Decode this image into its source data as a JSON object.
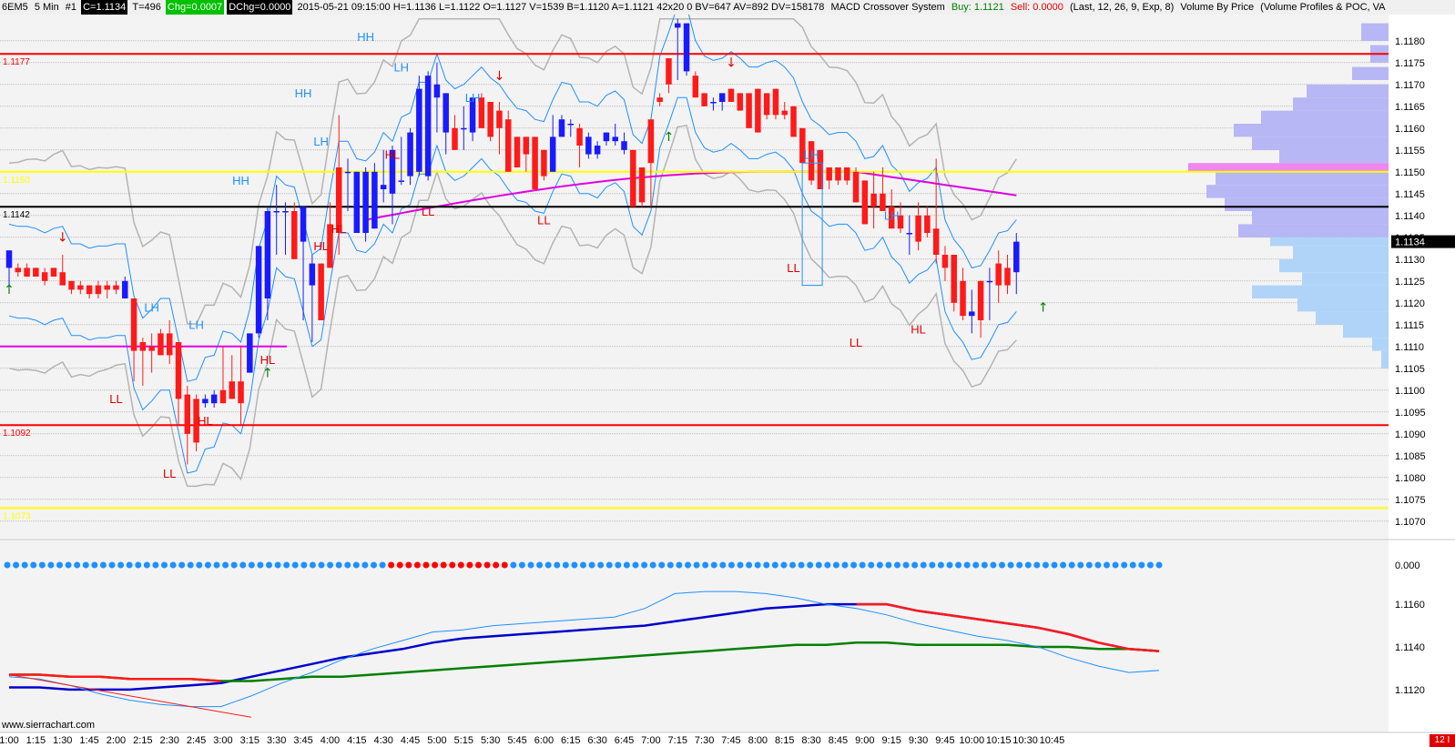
{
  "header": {
    "symbol": "6EM5",
    "timeframe": "5 Min",
    "chart_number": "#1",
    "close": "C=1.1134",
    "trades": "T=496",
    "chg": "Chg=0.0007",
    "dchg": "DChg=0.0000",
    "bar_info": "2015-05-21 09:15:00 H=1.1136 L=1.1122 O=1.1127 V=1539 B=1.1120 A=1.1121 42x20 0 BV=647 AV=892 DV=158178",
    "study": "MACD Crossover System",
    "buy": "Buy: 1.1121",
    "sell": "Sell: 0.0000",
    "study_params": "(Last, 12, 26, 9, Exp, 8)",
    "study2": "Volume By Price",
    "study3": "(Volume Profiles & POC, VA"
  },
  "footer": {
    "watermark": "www.sierrachart.com",
    "badge": "12 I"
  },
  "colors": {
    "bg": "#f3f3f3",
    "up": "#1a1aff",
    "down": "#ff1a1a",
    "grid": "#9a9a9a",
    "red_line": "#ff0000",
    "yellow_line": "#ffff00",
    "magenta": "#e000e0",
    "band_blue": "#1e90ff",
    "band_gray": "#b4b4b4",
    "label_blue": "#1e90ff",
    "label_red": "#e00000",
    "profile_a": "#b7b7f5",
    "profile_b": "#b0d4f8",
    "macd_fast": "#0000cc",
    "macd_signal": "#008000"
  },
  "chart_data": {
    "type": "candlestick",
    "price_axis": {
      "ylim": [
        1.1066,
        1.1186
      ],
      "ticks": [
        "1.1180",
        "1.1175",
        "1.1170",
        "1.1165",
        "1.1160",
        "1.1155",
        "1.1150",
        "1.1145",
        "1.1140",
        "1.1135",
        "1.1130",
        "1.1125",
        "1.1120",
        "1.1115",
        "1.1110",
        "1.1105",
        "1.1100",
        "1.1095",
        "1.1090",
        "1.1085",
        "1.1080",
        "1.1075",
        "1.1070"
      ],
      "current_price": "1.1134"
    },
    "time_labels": [
      "1:00",
      "1:15",
      "1:30",
      "1:45",
      "2:00",
      "2:15",
      "2:30",
      "2:45",
      "3:00",
      "3:15",
      "3:30",
      "3:45",
      "4:00",
      "4:15",
      "4:30",
      "4:45",
      "5:00",
      "5:15",
      "5:30",
      "5:45",
      "6:00",
      "6:15",
      "6:30",
      "6:45",
      "7:00",
      "7:15",
      "7:30",
      "7:45",
      "8:00",
      "8:15",
      "8:30",
      "8:45",
      "9:00",
      "9:15",
      "9:30",
      "9:45",
      "10:00",
      "10:15",
      "10:30",
      "10:45"
    ],
    "candles": [
      [
        1.1128,
        1.1132,
        1.1124,
        1.1132
      ],
      [
        1.1128,
        1.1129,
        1.1126,
        1.1127
      ],
      [
        1.1128,
        1.1129,
        1.1126,
        1.1126
      ],
      [
        1.1128,
        1.1128,
        1.1126,
        1.1126
      ],
      [
        1.1127,
        1.1128,
        1.1124,
        1.1125
      ],
      [
        1.1128,
        1.1128,
        1.1126,
        1.1126
      ],
      [
        1.1127,
        1.1131,
        1.1124,
        1.1124
      ],
      [
        1.1125,
        1.1125,
        1.1122,
        1.1123
      ],
      [
        1.1124,
        1.1125,
        1.1122,
        1.1123
      ],
      [
        1.1124,
        1.1124,
        1.1121,
        1.1122
      ],
      [
        1.1124,
        1.1125,
        1.1121,
        1.1122
      ],
      [
        1.1124,
        1.1125,
        1.1121,
        1.1123
      ],
      [
        1.1124,
        1.1125,
        1.1122,
        1.1123
      ],
      [
        1.1121,
        1.1126,
        1.1121,
        1.1125
      ],
      [
        1.1121,
        1.1121,
        1.1102,
        1.1109
      ],
      [
        1.1111,
        1.1112,
        1.1101,
        1.1109
      ],
      [
        1.111,
        1.1113,
        1.1104,
        1.1109
      ],
      [
        1.1113,
        1.1114,
        1.1108,
        1.1108
      ],
      [
        1.1113,
        1.1116,
        1.1106,
        1.1108
      ],
      [
        1.1111,
        1.1111,
        1.1092,
        1.1098
      ],
      [
        1.1099,
        1.1101,
        1.1083,
        1.109
      ],
      [
        1.1098,
        1.1099,
        1.1086,
        1.1088
      ],
      [
        1.1097,
        1.1099,
        1.1096,
        1.1098
      ],
      [
        1.1097,
        1.11,
        1.1096,
        1.1099
      ],
      [
        1.11,
        1.111,
        1.1097,
        1.1097
      ],
      [
        1.1102,
        1.1108,
        1.1098,
        1.1098
      ],
      [
        1.1102,
        1.111,
        1.1092,
        1.1097
      ],
      [
        1.1104,
        1.1113,
        1.1104,
        1.1113
      ],
      [
        1.1113,
        1.1133,
        1.1112,
        1.1133
      ],
      [
        1.1121,
        1.1142,
        1.1116,
        1.1141
      ],
      [
        1.1141,
        1.1147,
        1.1131,
        1.1141
      ],
      [
        1.1141,
        1.1143,
        1.1131,
        1.1141
      ],
      [
        1.1141,
        1.1143,
        1.113,
        1.113
      ],
      [
        1.1134,
        1.1142,
        1.1116,
        1.1142
      ],
      [
        1.1124,
        1.1131,
        1.1111,
        1.1129
      ],
      [
        1.1129,
        1.1129,
        1.1116,
        1.1116
      ],
      [
        1.1138,
        1.1143,
        1.1128,
        1.1128
      ],
      [
        1.1151,
        1.1163,
        1.1131,
        1.1136
      ],
      [
        1.115,
        1.1153,
        1.1141,
        1.115
      ],
      [
        1.1136,
        1.115,
        1.1136,
        1.115
      ],
      [
        1.1136,
        1.1151,
        1.1134,
        1.115
      ],
      [
        1.1137,
        1.1152,
        1.1137,
        1.115
      ],
      [
        1.1146,
        1.1155,
        1.1143,
        1.1147
      ],
      [
        1.1145,
        1.1156,
        1.1138,
        1.1155
      ],
      [
        1.1148,
        1.1158,
        1.1147,
        1.1148
      ],
      [
        1.1149,
        1.116,
        1.1147,
        1.1159
      ],
      [
        1.115,
        1.1172,
        1.1149,
        1.1169
      ],
      [
        1.1149,
        1.1173,
        1.1148,
        1.1172
      ],
      [
        1.1167,
        1.1175,
        1.1159,
        1.117
      ],
      [
        1.1159,
        1.1168,
        1.1154,
        1.1168
      ],
      [
        1.116,
        1.1163,
        1.1155,
        1.1155
      ],
      [
        1.116,
        1.1165,
        1.1155,
        1.116
      ],
      [
        1.1159,
        1.1167,
        1.1157,
        1.1167
      ],
      [
        1.1167,
        1.1168,
        1.116,
        1.116
      ],
      [
        1.1166,
        1.1166,
        1.1157,
        1.1158
      ],
      [
        1.1164,
        1.1166,
        1.1154,
        1.116
      ],
      [
        1.1162,
        1.1164,
        1.115,
        1.115
      ],
      [
        1.1158,
        1.1158,
        1.1151,
        1.1151
      ],
      [
        1.1158,
        1.1158,
        1.115,
        1.1154
      ],
      [
        1.1158,
        1.1158,
        1.1146,
        1.1146
      ],
      [
        1.1155,
        1.1155,
        1.1148,
        1.1149
      ],
      [
        1.115,
        1.1163,
        1.115,
        1.1158
      ],
      [
        1.1158,
        1.1163,
        1.1158,
        1.1162
      ],
      [
        1.1161,
        1.1162,
        1.1158,
        1.1161
      ],
      [
        1.116,
        1.1161,
        1.1151,
        1.1156
      ],
      [
        1.1154,
        1.1159,
        1.1153,
        1.1158
      ],
      [
        1.1154,
        1.1157,
        1.1153,
        1.1156
      ],
      [
        1.1157,
        1.1159,
        1.1156,
        1.1159
      ],
      [
        1.1157,
        1.1161,
        1.1156,
        1.1158
      ],
      [
        1.1155,
        1.1159,
        1.1154,
        1.1157
      ],
      [
        1.1155,
        1.1155,
        1.1142,
        1.1142
      ],
      [
        1.1151,
        1.1151,
        1.1142,
        1.1143
      ],
      [
        1.1162,
        1.1162,
        1.1142,
        1.1152
      ],
      [
        1.1167,
        1.1168,
        1.1165,
        1.1166
      ],
      [
        1.1176,
        1.1176,
        1.1168,
        1.117
      ],
      [
        1.1183,
        1.1185,
        1.1171,
        1.1184
      ],
      [
        1.1173,
        1.1184,
        1.1172,
        1.1184
      ],
      [
        1.1172,
        1.1173,
        1.1167,
        1.1167
      ],
      [
        1.1168,
        1.1168,
        1.1165,
        1.1165
      ],
      [
        1.1166,
        1.1167,
        1.1164,
        1.1166
      ],
      [
        1.1166,
        1.1168,
        1.1164,
        1.1168
      ],
      [
        1.1169,
        1.1169,
        1.1166,
        1.1166
      ],
      [
        1.1168,
        1.1168,
        1.1164,
        1.1164
      ],
      [
        1.1168,
        1.1168,
        1.116,
        1.116
      ],
      [
        1.1169,
        1.1169,
        1.1159,
        1.1159
      ],
      [
        1.1168,
        1.1168,
        1.1162,
        1.1163
      ],
      [
        1.1169,
        1.1169,
        1.1162,
        1.1163
      ],
      [
        1.1164,
        1.1166,
        1.1162,
        1.1163
      ],
      [
        1.1165,
        1.1165,
        1.1158,
        1.1158
      ],
      [
        1.116,
        1.116,
        1.1152,
        1.1152
      ],
      [
        1.1157,
        1.1157,
        1.1147,
        1.1148
      ],
      [
        1.1155,
        1.1155,
        1.1146,
        1.1146
      ],
      [
        1.1151,
        1.1151,
        1.1146,
        1.1148
      ],
      [
        1.1151,
        1.1151,
        1.1147,
        1.1148
      ],
      [
        1.1151,
        1.1151,
        1.1147,
        1.1148
      ],
      [
        1.115,
        1.1151,
        1.1143,
        1.1143
      ],
      [
        1.1148,
        1.1148,
        1.1138,
        1.1138
      ],
      [
        1.1145,
        1.115,
        1.1137,
        1.1142
      ],
      [
        1.1145,
        1.1151,
        1.1141,
        1.1141
      ],
      [
        1.1142,
        1.1146,
        1.1137,
        1.1137
      ],
      [
        1.114,
        1.1143,
        1.1136,
        1.1137
      ],
      [
        1.1136,
        1.114,
        1.1131,
        1.1136
      ],
      [
        1.114,
        1.1143,
        1.1132,
        1.1134
      ],
      [
        1.114,
        1.1142,
        1.1135,
        1.1136
      ],
      [
        1.1137,
        1.1153,
        1.1129,
        1.1131
      ],
      [
        1.1131,
        1.1133,
        1.1125,
        1.1128
      ],
      [
        1.1131,
        1.1131,
        1.1118,
        1.112
      ],
      [
        1.1125,
        1.1128,
        1.1116,
        1.1117
      ],
      [
        1.1117,
        1.1123,
        1.1113,
        1.1118
      ],
      [
        1.1125,
        1.1125,
        1.1112,
        1.1116
      ],
      [
        1.1125,
        1.1128,
        1.1116,
        1.1125
      ],
      [
        1.1129,
        1.1132,
        1.112,
        1.1124
      ],
      [
        1.1128,
        1.1131,
        1.1122,
        1.1124
      ],
      [
        1.1127,
        1.1136,
        1.1122,
        1.1134
      ]
    ],
    "horizontal_levels": [
      {
        "price": 1.1177,
        "label": "1.1177",
        "color": "red"
      },
      {
        "price": 1.115,
        "label": "1.1150",
        "color": "yellow"
      },
      {
        "price": 1.1142,
        "label": "1.1142",
        "color": "black"
      },
      {
        "price": 1.1092,
        "label": "1.1092",
        "color": "red"
      },
      {
        "price": 1.1073,
        "label": "1.1073",
        "color": "yellow"
      }
    ],
    "swing_labels": [
      {
        "text": "HH",
        "time": "4:20",
        "price": 1.118,
        "color": "blue"
      },
      {
        "text": "LH",
        "time": "4:40",
        "price": 1.1173,
        "color": "blue"
      },
      {
        "text": "HH",
        "time": "3:45",
        "price": 1.1167,
        "color": "blue"
      },
      {
        "text": "LH",
        "time": "5:20",
        "price": 1.1166,
        "color": "blue"
      },
      {
        "text": "LH",
        "time": "3:55",
        "price": 1.1156,
        "color": "blue"
      },
      {
        "text": "HL",
        "time": "4:35",
        "price": 1.1153,
        "color": "red"
      },
      {
        "text": "HH",
        "time": "3:10",
        "price": 1.1147,
        "color": "blue"
      },
      {
        "text": "LL",
        "time": "4:55",
        "price": 1.114,
        "color": "red"
      },
      {
        "text": "LL",
        "time": "6:00",
        "price": 1.1138,
        "color": "red"
      },
      {
        "text": "HL",
        "time": "4:05",
        "price": 1.1136,
        "color": "red"
      },
      {
        "text": "HL",
        "time": "3:55",
        "price": 1.1132,
        "color": "red"
      },
      {
        "text": "LH",
        "time": "8:30",
        "price": 1.1153,
        "color": "blue"
      },
      {
        "text": "LH",
        "time": "9:15",
        "price": 1.1139,
        "color": "blue"
      },
      {
        "text": "LL",
        "time": "8:20",
        "price": 1.1127,
        "color": "red"
      },
      {
        "text": "HL",
        "time": "9:30",
        "price": 1.1113,
        "color": "red"
      },
      {
        "text": "LL",
        "time": "8:55",
        "price": 1.111,
        "color": "red"
      },
      {
        "text": "HL",
        "time": "3:25",
        "price": 1.1106,
        "color": "red"
      },
      {
        "text": "LH",
        "time": "2:20",
        "price": 1.1118,
        "color": "blue"
      },
      {
        "text": "LH",
        "time": "2:45",
        "price": 1.1114,
        "color": "blue"
      },
      {
        "text": "LL",
        "time": "2:00",
        "price": 1.1097,
        "color": "red"
      },
      {
        "text": "HL",
        "time": "2:50",
        "price": 1.1092,
        "color": "red"
      },
      {
        "text": "LL",
        "time": "2:30",
        "price": 1.108,
        "color": "red"
      }
    ],
    "macd_dots_axis_label": "0.000",
    "macd_dots": "BBBBBBBBBBBBBBBBBBBBBBBBBBBBBBBBBBBBBBBBBBBBRRRRRRRRRRRRRRBBBBBBBBBBBBBBBBBBBBBBBBBBBBBBBBBBBBBBBBBBBBBBBBBBBBBBBBBBBBBBBBBBBBBBBBBBB",
    "lower_axis": {
      "ylim": [
        1.1108,
        1.1172
      ],
      "ticks": [
        "1.1160",
        "1.1140",
        "1.1120"
      ]
    },
    "lower_series": [
      {
        "name": "fast",
        "color": "#0000cc",
        "values": [
          1.1121,
          1.1121,
          1.112,
          1.112,
          1.112,
          1.1121,
          1.1122,
          1.1123,
          1.1126,
          1.1129,
          1.1132,
          1.1135,
          1.1137,
          1.1139,
          1.1142,
          1.1144,
          1.1145,
          1.1146,
          1.1147,
          1.1148,
          1.1149,
          1.115,
          1.1152,
          1.1154,
          1.1156,
          1.1158,
          1.1159,
          1.116,
          1.116,
          1.116,
          1.1157,
          1.1155,
          1.1153,
          1.1151,
          1.1149,
          1.1146,
          1.1142,
          1.1139,
          1.1138
        ]
      },
      {
        "name": "signal",
        "color": "#008000",
        "values": [
          1.1127,
          1.1127,
          1.1126,
          1.1126,
          1.1125,
          1.1125,
          1.1125,
          1.1124,
          1.1124,
          1.1125,
          1.1126,
          1.1126,
          1.1127,
          1.1128,
          1.1129,
          1.113,
          1.1131,
          1.1132,
          1.1133,
          1.1134,
          1.1135,
          1.1136,
          1.1137,
          1.1138,
          1.1139,
          1.114,
          1.1141,
          1.1141,
          1.1142,
          1.1142,
          1.1141,
          1.1141,
          1.1141,
          1.1141,
          1.114,
          1.114,
          1.1139,
          1.1139,
          1.1138
        ]
      },
      {
        "name": "thin",
        "color": "#1e90ff",
        "values": [
          1.1126,
          1.1125,
          1.1122,
          1.1118,
          1.1115,
          1.1113,
          1.1112,
          1.1112,
          1.1117,
          1.1123,
          1.1128,
          1.1134,
          1.1139,
          1.1143,
          1.1147,
          1.1148,
          1.115,
          1.1151,
          1.1152,
          1.1153,
          1.1154,
          1.1158,
          1.1165,
          1.1166,
          1.1166,
          1.1165,
          1.1163,
          1.116,
          1.1158,
          1.1155,
          1.1151,
          1.1148,
          1.1145,
          1.1143,
          1.114,
          1.1135,
          1.1131,
          1.1128,
          1.1129
        ]
      }
    ]
  }
}
